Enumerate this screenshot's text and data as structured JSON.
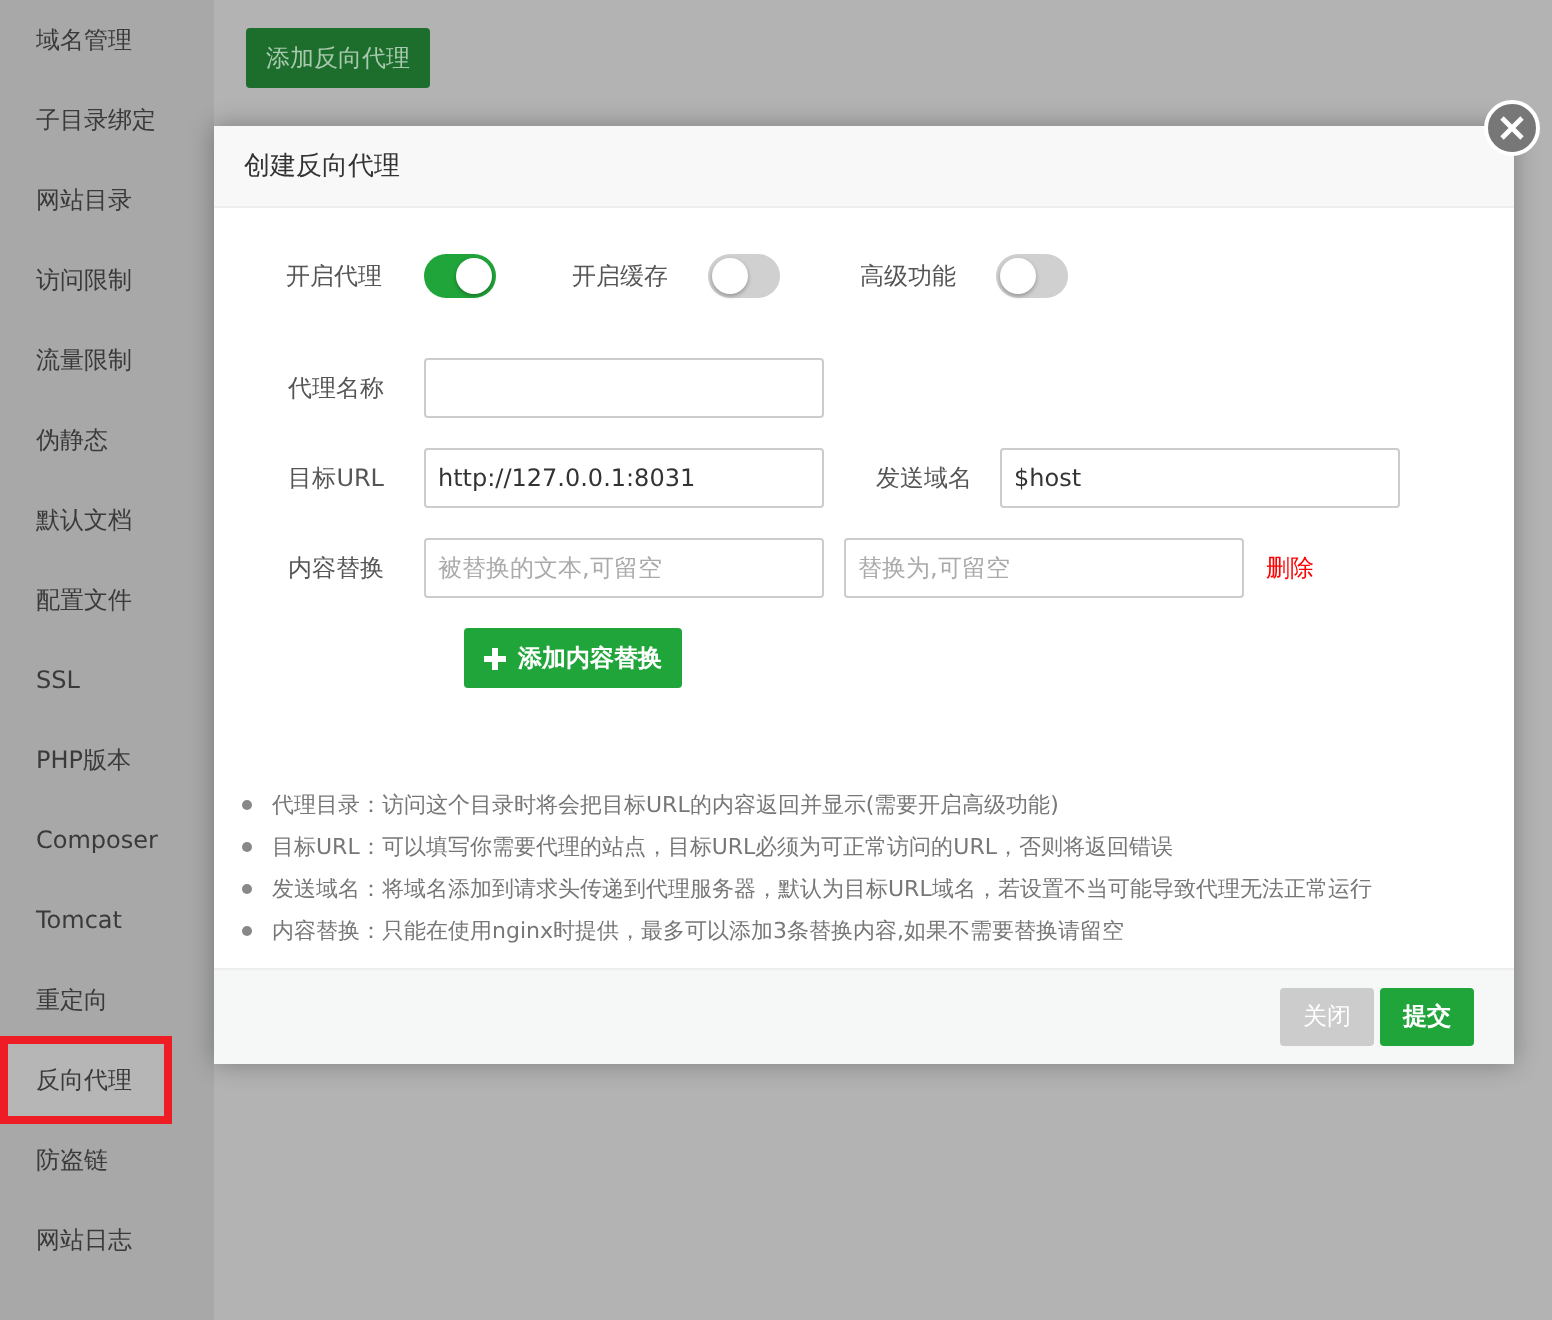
{
  "sidebar": {
    "items": [
      {
        "label": "域名管理",
        "selected": false
      },
      {
        "label": "子目录绑定",
        "selected": false
      },
      {
        "label": "网站目录",
        "selected": false
      },
      {
        "label": "访问限制",
        "selected": false
      },
      {
        "label": "流量限制",
        "selected": false
      },
      {
        "label": "伪静态",
        "selected": false
      },
      {
        "label": "默认文档",
        "selected": false
      },
      {
        "label": "配置文件",
        "selected": false
      },
      {
        "label": "SSL",
        "selected": false
      },
      {
        "label": "PHP版本",
        "selected": false
      },
      {
        "label": "Composer",
        "selected": false
      },
      {
        "label": "Tomcat",
        "selected": false
      },
      {
        "label": "重定向",
        "selected": false
      },
      {
        "label": "反向代理",
        "selected": true,
        "highlighted": true
      },
      {
        "label": "防盗链",
        "selected": false
      },
      {
        "label": "网站日志",
        "selected": false
      }
    ]
  },
  "toolbar": {
    "add_button": "添加反向代理"
  },
  "dialog": {
    "title": "创建反向代理",
    "toggles": [
      {
        "label": "开启代理",
        "on": true
      },
      {
        "label": "开启缓存",
        "on": false
      },
      {
        "label": "高级功能",
        "on": false
      }
    ],
    "proxy_name": {
      "label": "代理名称"
    },
    "target_url": {
      "label": "目标URL",
      "value": "http://127.0.0.1:8031"
    },
    "send_domain": {
      "label": "发送域名",
      "value": "$host"
    },
    "content_replace": {
      "label": "内容替换",
      "from_placeholder": "被替换的文本,可留空",
      "to_placeholder": "替换为,可留空",
      "delete_link": "删除"
    },
    "add_replace_button": "添加内容替换",
    "notes": [
      "代理目录：访问这个目录时将会把目标URL的内容返回并显示(需要开启高级功能)",
      "目标URL：可以填写你需要代理的站点，目标URL必须为可正常访问的URL，否则将返回错误",
      "发送域名：将域名添加到请求头传递到代理服务器，默认为目标URL域名，若设置不当可能导致代理无法正常运行",
      "内容替换：只能在使用nginx时提供，最多可以添加3条替换内容,如果不需要替换请留空"
    ],
    "buttons": [
      {
        "label": "关闭",
        "kind": "secondary"
      },
      {
        "label": "提交",
        "kind": "primary"
      }
    ]
  }
}
